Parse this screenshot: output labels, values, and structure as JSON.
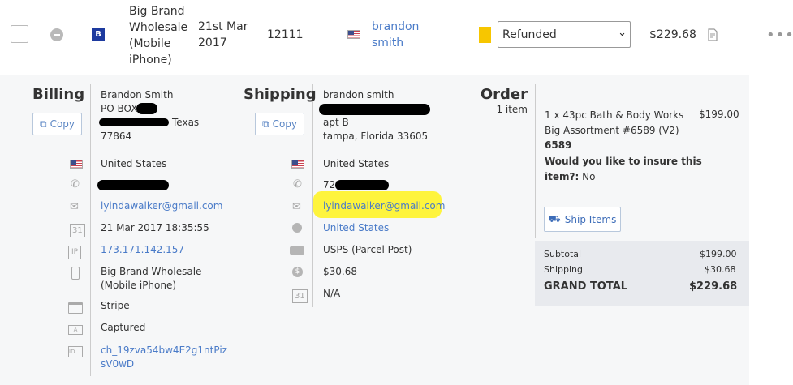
{
  "order_row": {
    "store_name": [
      "Big Brand",
      "Wholesale",
      "(Mobile",
      "iPhone)"
    ],
    "date": [
      "21st Mar",
      "2017"
    ],
    "order_number": "12111",
    "customer_name": [
      "brandon",
      "smith"
    ],
    "status": "Refunded",
    "total": "$229.68"
  },
  "billing": {
    "heading": "Billing",
    "copy_label": "Copy",
    "name": "Brandon Smith",
    "address1": "PO BOX",
    "address2_tail": "Texas",
    "zip": "77864",
    "country": "United States",
    "email": "lyindawalker@gmail.com",
    "date": "21 Mar 2017 18:35:55",
    "ip": "173.171.142.157",
    "source": [
      "Big Brand Wholesale",
      "(Mobile iPhone)"
    ],
    "payment_method": "Stripe",
    "payment_status": "Captured",
    "transaction_id": [
      "ch_19zva54bw4E2g1ntPiz",
      "sV0wD"
    ]
  },
  "shipping": {
    "heading": "Shipping",
    "copy_label": "Copy",
    "name": "brandon smith",
    "address2": "apt B",
    "city_line": "tampa, Florida 33605",
    "country": "United States",
    "phone_prefix": "721",
    "email": "lyindawalker@gmail.com",
    "website_country": "United States",
    "shipping_method": "USPS (Parcel Post)",
    "shipping_cost": "$30.68",
    "date": "N/A"
  },
  "order": {
    "heading": "Order",
    "item_count": "1 item",
    "item_title": [
      "1 x 43pc Bath & Body Works",
      "Big Assortment #6589 (V2)"
    ],
    "item_price": "$199.00",
    "sku": "6589",
    "insure_question": [
      "Would you like to insure this",
      "item?:"
    ],
    "insure_answer": "No",
    "ship_button": "Ship Items",
    "subtotal_label": "Subtotal",
    "subtotal": "$199.00",
    "shipping_label": "Shipping",
    "shipping": "$30.68",
    "grand_total_label": "GRAND TOTAL",
    "grand_total": "$229.68"
  },
  "colors": {
    "accent": "#4a7bc8",
    "status": "#f7c600",
    "highlight": "#fef43d"
  }
}
